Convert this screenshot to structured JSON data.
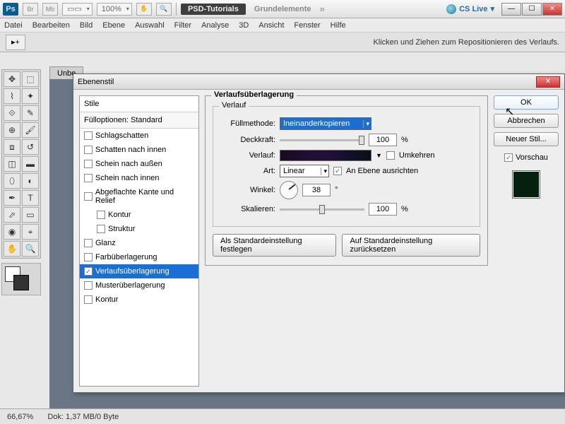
{
  "top": {
    "br": "Br",
    "mb": "Mb",
    "zoom": "100%",
    "project": "PSD-Tutorials",
    "elements": "Grundelemente",
    "cslive": "CS Live"
  },
  "menu": [
    "Datei",
    "Bearbeiten",
    "Bild",
    "Ebene",
    "Auswahl",
    "Filter",
    "Analyse",
    "3D",
    "Ansicht",
    "Fenster",
    "Hilfe"
  ],
  "options": {
    "hint": "Klicken und Ziehen zum Repositionieren des Verlaufs."
  },
  "doc": {
    "tab": "Unbe"
  },
  "dialog": {
    "title": "Ebenenstil",
    "styles_head": "Stile",
    "fill_options": "Fülloptionen: Standard",
    "items": [
      {
        "label": "Schlagschatten",
        "checked": false
      },
      {
        "label": "Schatten nach innen",
        "checked": false
      },
      {
        "label": "Schein nach außen",
        "checked": false
      },
      {
        "label": "Schein nach innen",
        "checked": false
      },
      {
        "label": "Abgeflachte Kante und Relief",
        "checked": false
      },
      {
        "label": "Kontur",
        "checked": false,
        "indent": true
      },
      {
        "label": "Struktur",
        "checked": false,
        "indent": true
      },
      {
        "label": "Glanz",
        "checked": false
      },
      {
        "label": "Farbüberlagerung",
        "checked": false
      },
      {
        "label": "Verlaufsüberlagerung",
        "checked": true,
        "selected": true
      },
      {
        "label": "Musterüberlagerung",
        "checked": false
      },
      {
        "label": "Kontur",
        "checked": false
      }
    ],
    "section_title": "Verlaufsüberlagerung",
    "group_title": "Verlauf",
    "blend_label": "Füllmethode:",
    "blend_value": "Ineinanderkopieren",
    "opacity_label": "Deckkraft:",
    "opacity_value": "100",
    "percent": "%",
    "gradient_label": "Verlauf:",
    "reverse_label": "Umkehren",
    "style_label": "Art:",
    "style_value": "Linear",
    "align_label": "An Ebene ausrichten",
    "angle_label": "Winkel:",
    "angle_value": "38",
    "degree": "°",
    "scale_label": "Skalieren:",
    "scale_value": "100",
    "std_set": "Als Standardeinstellung festlegen",
    "std_reset": "Auf Standardeinstellung zurücksetzen",
    "ok": "OK",
    "cancel": "Abbrechen",
    "new_style": "Neuer Stil...",
    "preview": "Vorschau"
  },
  "status": {
    "zoom": "66,67%",
    "doc": "Dok: 1,37 MB/0 Byte"
  }
}
